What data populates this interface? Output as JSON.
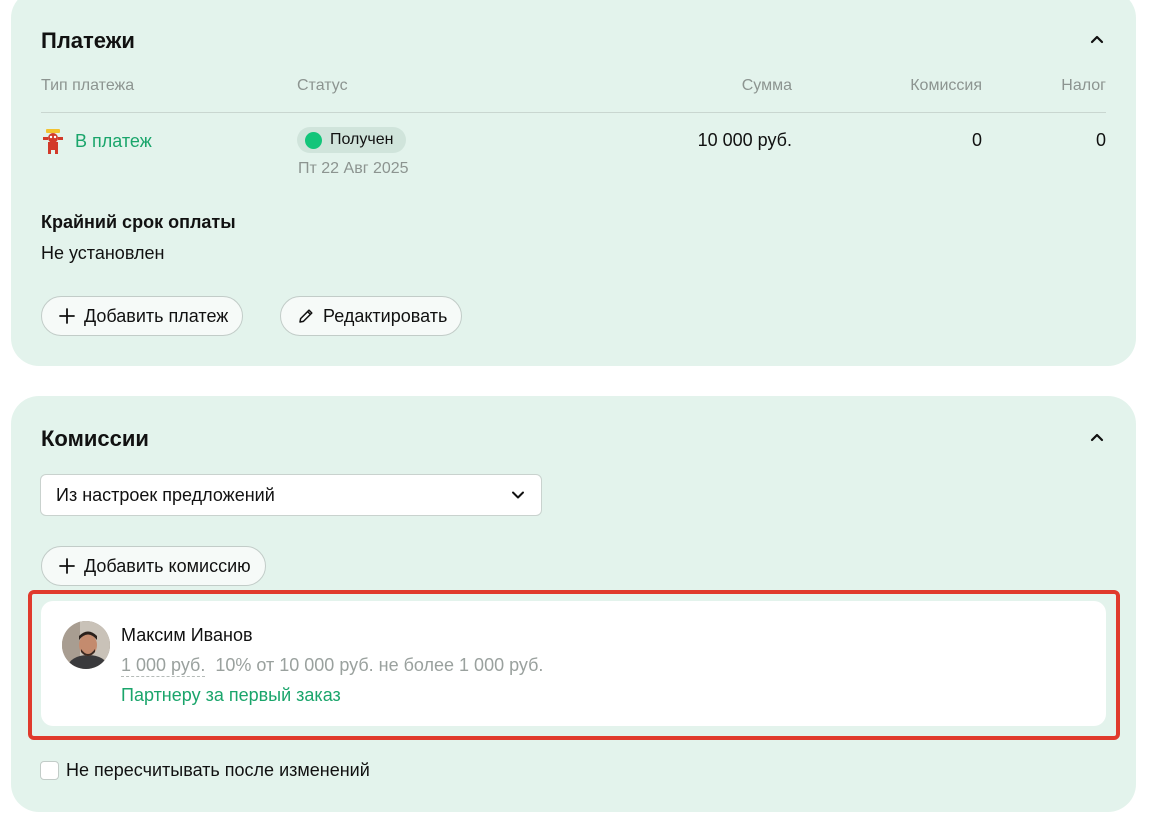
{
  "payments": {
    "title": "Платежи",
    "columns": {
      "type": "Тип платежа",
      "status": "Статус",
      "amount": "Сумма",
      "commission": "Комиссия",
      "tax": "Налог"
    },
    "row": {
      "type_label": "В платеж",
      "status": "Получен",
      "date": "Пт 22 Авг 2025",
      "amount": "10 000 руб.",
      "commission": "0",
      "tax": "0"
    },
    "deadline_label": "Крайний срок оплаты",
    "deadline_value": "Не установлен",
    "add_payment_label": "Добавить платеж",
    "edit_label": "Редактировать"
  },
  "commissions": {
    "title": "Комиссии",
    "select_value": "Из настроек предложений",
    "add_commission_label": "Добавить комиссию",
    "item": {
      "name": "Максим Иванов",
      "amount": "1 000 руб.",
      "formula": "10% от 10 000 руб. не более 1 000 руб.",
      "rule": "Партнеру за первый заказ"
    },
    "no_recalc_label": "Не пересчитывать после изменений"
  },
  "colors": {
    "card_bg": "#e3f3ec",
    "accent_green": "#1aa56b",
    "status_dot": "#13c57a",
    "highlight_border": "#e03a2c"
  },
  "icons": {
    "collapse": "chevron-up-icon",
    "payment_type": "service-logo-icon",
    "add": "plus-icon",
    "edit": "pencil-icon",
    "select": "chevron-down-icon"
  }
}
